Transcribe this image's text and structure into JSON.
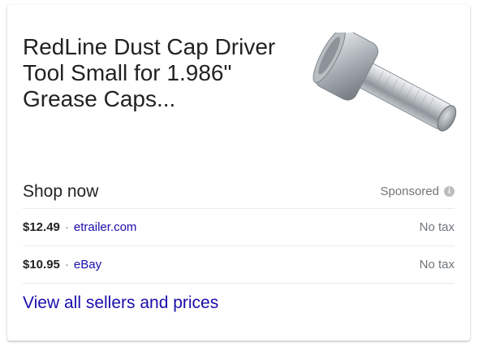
{
  "product": {
    "title": "RedLine Dust Cap Driver Tool Small for 1.986\" Grease Caps...",
    "image_icon": "dust-cap-driver-tool-photo"
  },
  "shop": {
    "label": "Shop now",
    "sponsored_label": "Sponsored",
    "info_icon": "i"
  },
  "offers": [
    {
      "price": "$12.49",
      "separator": "·",
      "seller": "etrailer.com",
      "tax": "No tax"
    },
    {
      "price": "$10.95",
      "separator": "·",
      "seller": "eBay",
      "tax": "No tax"
    }
  ],
  "footer": {
    "view_all_label": "View all sellers and prices"
  },
  "colors": {
    "link": "#1a0dab",
    "text": "#222222",
    "muted": "#70757a"
  }
}
